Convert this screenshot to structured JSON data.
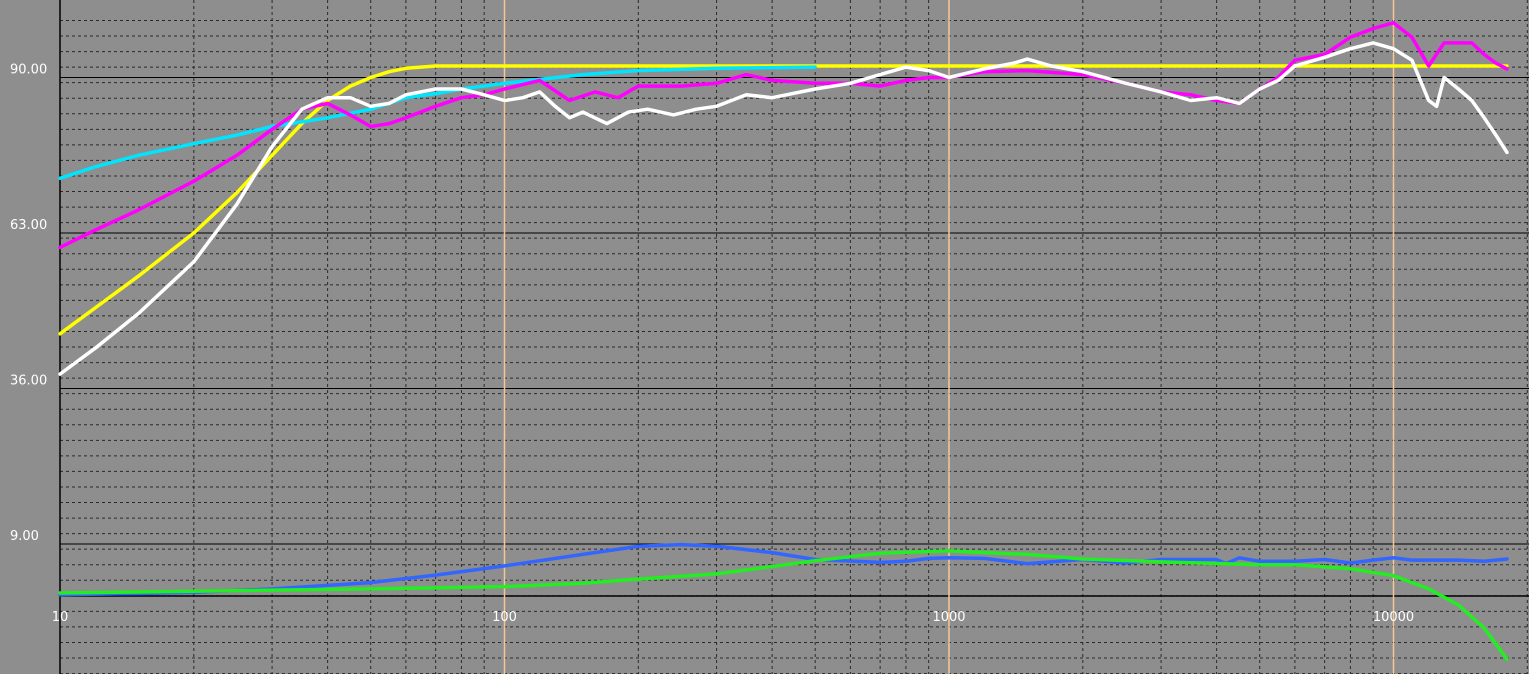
{
  "chart_data": {
    "type": "line",
    "title": "",
    "xlabel": "",
    "ylabel": "",
    "xscale": "log",
    "xlim": [
      10,
      18000
    ],
    "ylim": [
      0,
      100
    ],
    "grid": true,
    "legend": "none",
    "background": "#8e8e8e",
    "colors": {
      "major_grid": "#000000",
      "minor_grid": "#2a2a2a",
      "decade_lines": "#f5c796",
      "tick_text": "#ffffff"
    },
    "y_ticks": [
      {
        "value": 90,
        "label": "90.00"
      },
      {
        "value": 63,
        "label": "63.00"
      },
      {
        "value": 36,
        "label": "36.00"
      },
      {
        "value": 9,
        "label": "9.00"
      }
    ],
    "x_ticks": [
      {
        "value": 10,
        "label": "10"
      },
      {
        "value": 100,
        "label": "100"
      },
      {
        "value": 1000,
        "label": "1000"
      },
      {
        "value": 10000,
        "label": "10000"
      }
    ],
    "series": [
      {
        "color": "#ffff00",
        "points": [
          [
            10,
            45.5
          ],
          [
            12,
            50
          ],
          [
            15,
            55.5
          ],
          [
            20,
            63
          ],
          [
            25,
            70
          ],
          [
            30,
            76.5
          ],
          [
            35,
            82
          ],
          [
            40,
            86
          ],
          [
            45,
            88.5
          ],
          [
            50,
            90
          ],
          [
            55,
            91
          ],
          [
            60,
            91.6
          ],
          [
            70,
            92
          ],
          [
            100,
            92
          ],
          [
            500,
            92
          ],
          [
            1000,
            92
          ],
          [
            5000,
            92
          ],
          [
            10000,
            92
          ],
          [
            18000,
            92
          ]
        ]
      },
      {
        "color": "#00e5ff",
        "points": [
          [
            10,
            72.5
          ],
          [
            12,
            74.5
          ],
          [
            15,
            76.5
          ],
          [
            20,
            78.5
          ],
          [
            25,
            80
          ],
          [
            30,
            81.5
          ],
          [
            40,
            83
          ],
          [
            50,
            84.5
          ],
          [
            60,
            86.5
          ],
          [
            70,
            87.2
          ],
          [
            80,
            88
          ],
          [
            100,
            89
          ],
          [
            150,
            90.5
          ],
          [
            200,
            91.2
          ],
          [
            300,
            91.6
          ],
          [
            500,
            91.8
          ]
        ]
      },
      {
        "color": "#ff00ff",
        "points": [
          [
            10,
            60.5
          ],
          [
            12,
            63.5
          ],
          [
            15,
            67
          ],
          [
            20,
            72
          ],
          [
            25,
            76.5
          ],
          [
            30,
            81
          ],
          [
            35,
            84.5
          ],
          [
            40,
            85.5
          ],
          [
            45,
            83.5
          ],
          [
            50,
            81.5
          ],
          [
            55,
            82
          ],
          [
            60,
            83
          ],
          [
            70,
            85
          ],
          [
            80,
            86.5
          ],
          [
            90,
            87
          ],
          [
            100,
            88
          ],
          [
            120,
            89.5
          ],
          [
            140,
            86
          ],
          [
            160,
            87.5
          ],
          [
            180,
            86.5
          ],
          [
            200,
            88.5
          ],
          [
            250,
            88.5
          ],
          [
            300,
            89
          ],
          [
            350,
            90.5
          ],
          [
            400,
            89.5
          ],
          [
            500,
            89
          ],
          [
            600,
            89
          ],
          [
            700,
            88.5
          ],
          [
            800,
            89.5
          ],
          [
            900,
            90
          ],
          [
            1000,
            90
          ],
          [
            1200,
            91
          ],
          [
            1500,
            91.2
          ],
          [
            2000,
            90.5
          ],
          [
            2500,
            89
          ],
          [
            3000,
            87.5
          ],
          [
            3500,
            87
          ],
          [
            4000,
            86
          ],
          [
            4500,
            85.5
          ],
          [
            5000,
            88
          ],
          [
            5500,
            90
          ],
          [
            6000,
            93
          ],
          [
            7000,
            94
          ],
          [
            8000,
            97
          ],
          [
            9000,
            98.5
          ],
          [
            10000,
            99.5
          ],
          [
            11000,
            97
          ],
          [
            12000,
            92
          ],
          [
            13000,
            96
          ],
          [
            14000,
            96
          ],
          [
            15000,
            96
          ],
          [
            16000,
            94
          ],
          [
            17000,
            92.5
          ],
          [
            18000,
            91.5
          ]
        ]
      },
      {
        "color": "#ffffff",
        "points": [
          [
            10,
            38.5
          ],
          [
            12,
            43
          ],
          [
            15,
            49
          ],
          [
            20,
            58
          ],
          [
            25,
            68
          ],
          [
            30,
            78
          ],
          [
            35,
            84.5
          ],
          [
            40,
            86.5
          ],
          [
            45,
            86.5
          ],
          [
            50,
            85
          ],
          [
            55,
            85.5
          ],
          [
            60,
            87
          ],
          [
            70,
            88
          ],
          [
            80,
            88
          ],
          [
            90,
            87
          ],
          [
            100,
            86
          ],
          [
            110,
            86.5
          ],
          [
            120,
            87.5
          ],
          [
            130,
            85
          ],
          [
            140,
            83
          ],
          [
            150,
            84
          ],
          [
            170,
            82
          ],
          [
            190,
            84
          ],
          [
            210,
            84.5
          ],
          [
            240,
            83.5
          ],
          [
            270,
            84.5
          ],
          [
            300,
            85
          ],
          [
            350,
            87
          ],
          [
            400,
            86.5
          ],
          [
            500,
            88
          ],
          [
            600,
            89
          ],
          [
            700,
            90.5
          ],
          [
            800,
            91.8
          ],
          [
            900,
            91.2
          ],
          [
            1000,
            90
          ],
          [
            1200,
            91.5
          ],
          [
            1400,
            92.5
          ],
          [
            1500,
            93.2
          ],
          [
            1700,
            92
          ],
          [
            2000,
            91
          ],
          [
            2500,
            89
          ],
          [
            3000,
            87.5
          ],
          [
            3500,
            86
          ],
          [
            4000,
            86.5
          ],
          [
            4500,
            85.5
          ],
          [
            5000,
            88
          ],
          [
            5500,
            89.5
          ],
          [
            6000,
            92
          ],
          [
            7000,
            93.5
          ],
          [
            8000,
            95
          ],
          [
            9000,
            96
          ],
          [
            10000,
            95
          ],
          [
            11000,
            93
          ],
          [
            12000,
            86
          ],
          [
            12500,
            85
          ],
          [
            13000,
            90
          ],
          [
            14000,
            88
          ],
          [
            15000,
            86
          ],
          [
            16000,
            83
          ],
          [
            17000,
            80
          ],
          [
            18000,
            77
          ]
        ]
      },
      {
        "color": "#3366ff",
        "points": [
          [
            10,
            0.2
          ],
          [
            15,
            0.4
          ],
          [
            20,
            0.6
          ],
          [
            30,
            1.2
          ],
          [
            50,
            2.3
          ],
          [
            70,
            3.6
          ],
          [
            100,
            5.2
          ],
          [
            150,
            7.2
          ],
          [
            200,
            8.6
          ],
          [
            250,
            8.9
          ],
          [
            300,
            8.6
          ],
          [
            400,
            7.5
          ],
          [
            500,
            6.3
          ],
          [
            700,
            5.8
          ],
          [
            800,
            6
          ],
          [
            900,
            6.5
          ],
          [
            1000,
            6.6
          ],
          [
            1200,
            6.5
          ],
          [
            1500,
            5.6
          ],
          [
            2000,
            6.3
          ],
          [
            2500,
            5.7
          ],
          [
            3000,
            6.3
          ],
          [
            4000,
            6.3
          ],
          [
            4200,
            5.6
          ],
          [
            4500,
            6.6
          ],
          [
            5000,
            6
          ],
          [
            6000,
            6
          ],
          [
            7000,
            6.3
          ],
          [
            8000,
            5.7
          ],
          [
            9000,
            6.2
          ],
          [
            10000,
            6.6
          ],
          [
            11000,
            6.2
          ],
          [
            12000,
            6.2
          ],
          [
            14000,
            6.2
          ],
          [
            16000,
            6
          ],
          [
            18000,
            6.4
          ]
        ]
      },
      {
        "color": "#22ee22",
        "points": [
          [
            10,
            0.5
          ],
          [
            20,
            0.8
          ],
          [
            50,
            1.2
          ],
          [
            100,
            1.6
          ],
          [
            150,
            2.2
          ],
          [
            200,
            2.9
          ],
          [
            300,
            3.8
          ],
          [
            400,
            5.1
          ],
          [
            500,
            6.1
          ],
          [
            700,
            7.4
          ],
          [
            1000,
            7.8
          ],
          [
            1500,
            7.2
          ],
          [
            2000,
            6.4
          ],
          [
            3000,
            5.9
          ],
          [
            5000,
            5.4
          ],
          [
            6000,
            5.4
          ],
          [
            8000,
            4.7
          ],
          [
            10000,
            3.5
          ],
          [
            12000,
            1.2
          ],
          [
            14000,
            -1.6
          ],
          [
            16000,
            -5.6
          ],
          [
            18000,
            -11
          ]
        ]
      }
    ]
  }
}
